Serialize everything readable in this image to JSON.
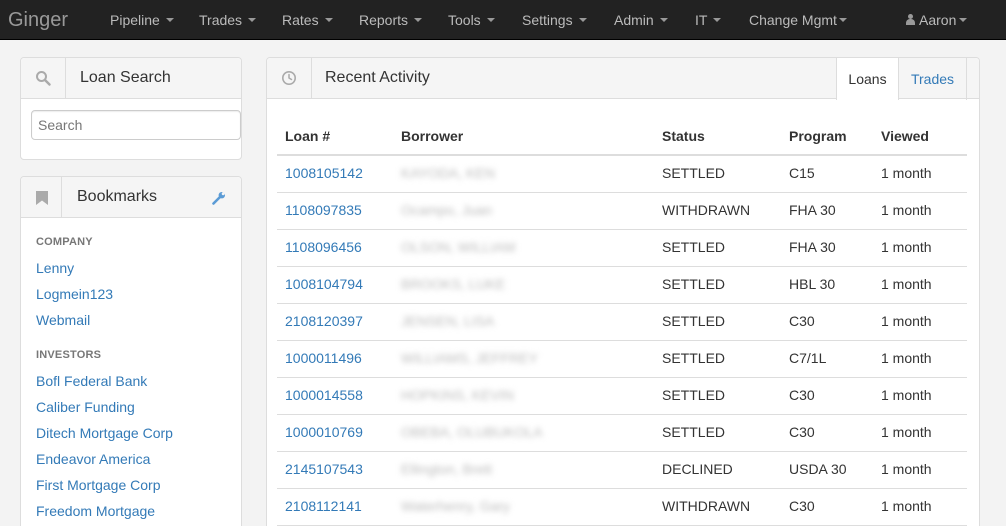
{
  "navbar": {
    "brand": "Ginger",
    "items": [
      {
        "label": "Pipeline"
      },
      {
        "label": "Trades"
      },
      {
        "label": "Rates"
      },
      {
        "label": "Reports"
      },
      {
        "label": "Tools"
      },
      {
        "label": "Settings"
      },
      {
        "label": "Admin"
      },
      {
        "label": "IT"
      },
      {
        "label": "Change Mgmt"
      }
    ],
    "user": "Aaron"
  },
  "loan_search": {
    "title": "Loan Search",
    "placeholder": "Search",
    "icon": "search-icon"
  },
  "bookmarks": {
    "title": "Bookmarks",
    "icon": "bookmark-icon",
    "edit_icon": "wrench-icon",
    "sections": [
      {
        "title": "COMPANY",
        "links": [
          "Lenny",
          "Logmein123",
          "Webmail"
        ]
      },
      {
        "title": "INVESTORS",
        "links": [
          "Bofl Federal Bank",
          "Caliber Funding",
          "Ditech Mortgage Corp",
          "Endeavor America",
          "First Mortgage Corp",
          "Freedom Mortgage"
        ]
      }
    ]
  },
  "recent_activity": {
    "title": "Recent Activity",
    "icon": "clock-icon",
    "tabs": [
      {
        "label": "Loans",
        "active": true
      },
      {
        "label": "Trades",
        "active": false
      }
    ],
    "columns": [
      "Loan #",
      "Borrower",
      "Status",
      "Program",
      "Viewed"
    ],
    "rows": [
      {
        "loan": "1008105142",
        "borrower": "KAYODA, KEN",
        "status": "SETTLED",
        "program": "C15",
        "viewed": "1 month"
      },
      {
        "loan": "1108097835",
        "borrower": "Ocampo, Juan",
        "status": "WITHDRAWN",
        "program": "FHA 30",
        "viewed": "1 month"
      },
      {
        "loan": "1108096456",
        "borrower": "OLSON, WILLIAM",
        "status": "SETTLED",
        "program": "FHA 30",
        "viewed": "1 month"
      },
      {
        "loan": "1008104794",
        "borrower": "BROOKS, LUKE",
        "status": "SETTLED",
        "program": "HBL 30",
        "viewed": "1 month"
      },
      {
        "loan": "2108120397",
        "borrower": "JENSEN, LISA",
        "status": "SETTLED",
        "program": "C30",
        "viewed": "1 month"
      },
      {
        "loan": "1000011496",
        "borrower": "WILLIAMS, JEFFREY",
        "status": "SETTLED",
        "program": "C7/1L",
        "viewed": "1 month"
      },
      {
        "loan": "1000014558",
        "borrower": "HOPKINS, KEVIN",
        "status": "SETTLED",
        "program": "C30",
        "viewed": "1 month"
      },
      {
        "loan": "1000010769",
        "borrower": "OBEBA, OLUBUKOLA",
        "status": "SETTLED",
        "program": "C30",
        "viewed": "1 month"
      },
      {
        "loan": "2145107543",
        "borrower": "Ellington, Brett",
        "status": "DECLINED",
        "program": "USDA 30",
        "viewed": "1 month"
      },
      {
        "loan": "2108112141",
        "borrower": "Waterhenry, Gary",
        "status": "WITHDRAWN",
        "program": "C30",
        "viewed": "1 month"
      }
    ]
  },
  "colors": {
    "navbar": "#222222",
    "link": "#337ab7",
    "panel_heading": "#f5f5f5",
    "border": "#dddddd",
    "wrench": "#5b9bd5"
  }
}
